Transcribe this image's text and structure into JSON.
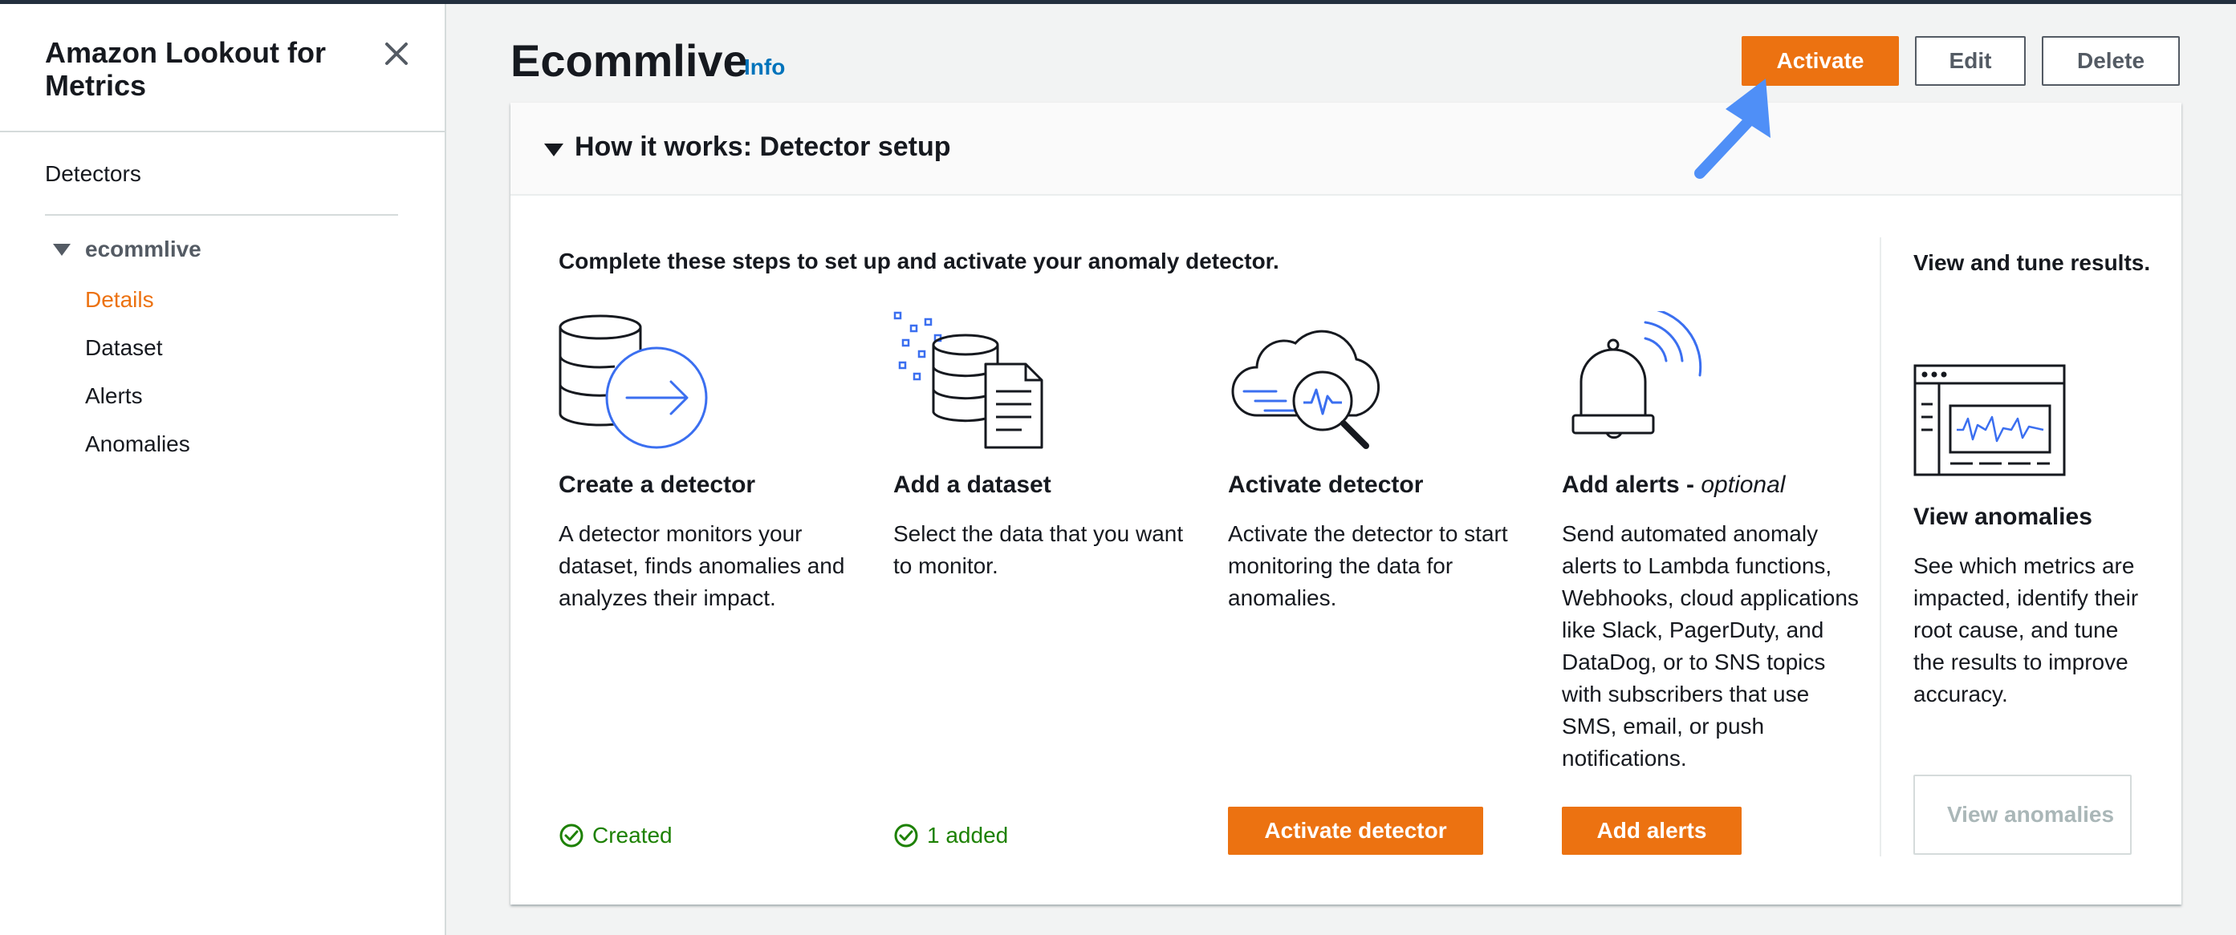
{
  "sidebar": {
    "title": "Amazon Lookout for Metrics",
    "detectors_label": "Detectors",
    "group_label": "ecommlive",
    "links": {
      "details": "Details",
      "dataset": "Dataset",
      "alerts": "Alerts",
      "anomalies": "Anomalies"
    },
    "active_link": "Details"
  },
  "header": {
    "title": "Ecommlive",
    "info": "Info",
    "activate_label": "Activate",
    "edit_label": "Edit",
    "delete_label": "Delete"
  },
  "panel": {
    "title": "How it works: Detector setup",
    "intro": "Complete these steps to set up and activate your anomaly detector.",
    "steps": [
      {
        "title": "Create a detector",
        "description": "A detector monitors your dataset, finds anomalies and analyzes their impact.",
        "status": "Created"
      },
      {
        "title": "Add a dataset",
        "description": "Select the data that you want to monitor.",
        "status": "1 added"
      },
      {
        "title": "Activate detector",
        "description": "Activate the detector to start monitoring the data for anomalies.",
        "button": "Activate detector"
      },
      {
        "title": "Add alerts - ",
        "title_suffix": "optional",
        "description": "Send automated anomaly alerts to Lambda functions, Webhooks, cloud applications like Slack, PagerDuty, and DataDog, or to SNS topics with subscribers that use SMS, email, or push notifications.",
        "button": "Add alerts"
      }
    ],
    "side": {
      "title": "View and tune results.",
      "subtitle": "View anomalies",
      "description": "See which metrics are impacted, identify their root cause, and tune the results to improve accuracy.",
      "button": "View anomalies"
    }
  },
  "colors": {
    "primary": "#ec7211",
    "link": "#0073bb",
    "success": "#1d8102",
    "annotation_arrow": "#4f8ff7",
    "illustration_accent": "#3b6ff0"
  }
}
